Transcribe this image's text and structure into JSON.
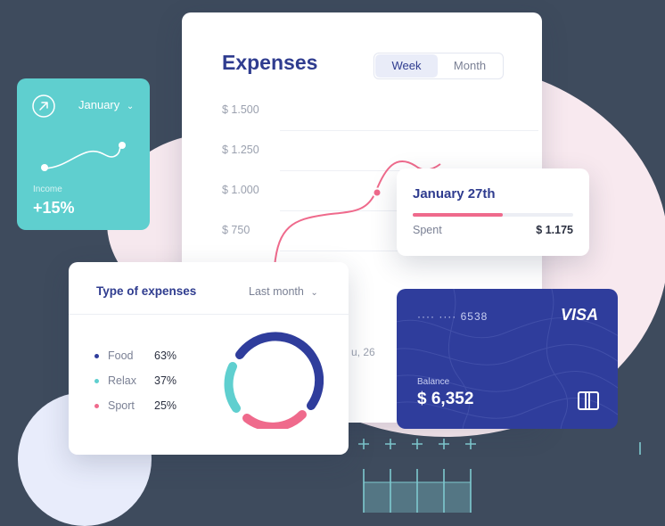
{
  "expenses": {
    "title": "Expenses",
    "toggle": {
      "week": "Week",
      "month": "Month",
      "selected": "Week"
    },
    "y_labels": [
      "$ 1.500",
      "$ 1.250",
      "$ 1.000",
      "$ 750"
    ],
    "x_label_partial": "u, 26"
  },
  "income": {
    "month_select": "January",
    "label": "Income",
    "value": "+15%"
  },
  "tooltip": {
    "title": "January 27th",
    "spent_label": "Spent",
    "spent_value": "$ 1.175",
    "progress": 0.56
  },
  "type_of_expenses": {
    "title": "Type of expenses",
    "period_select": "Last month",
    "items": [
      {
        "name": "Food",
        "percent": "63%",
        "color": "#2f3d9c"
      },
      {
        "name": "Relax",
        "percent": "37%",
        "color": "#5fcfcf"
      },
      {
        "name": "Sport",
        "percent": "25%",
        "color": "#ef6a8c"
      }
    ]
  },
  "card": {
    "number": "···· ···· 6538",
    "brand": "VISA",
    "balance_label": "Balance",
    "balance_value": "$ 6,352"
  },
  "colors": {
    "background": "#3e4b5d",
    "accent_blue": "#2f3d9c",
    "teal": "#5fcfcf",
    "pink": "#ef6a8c"
  }
}
